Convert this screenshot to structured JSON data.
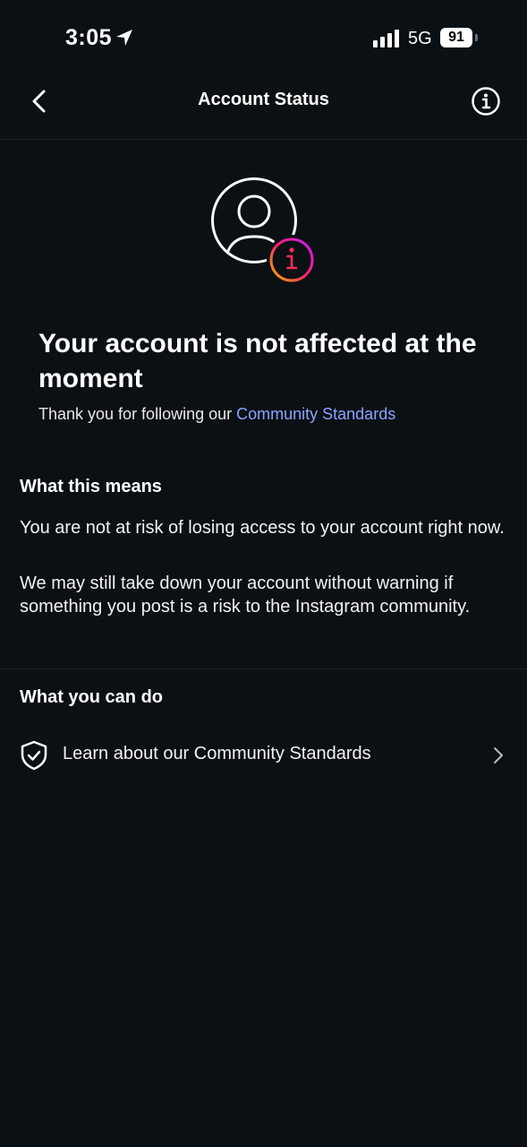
{
  "status_bar": {
    "time": "3:05",
    "network": "5G",
    "battery": "91"
  },
  "nav": {
    "title": "Account Status"
  },
  "status": {
    "headline": "Your account is not affected at the moment",
    "subtitle_prefix": "Thank you for following our ",
    "subtitle_link": "Community Standards"
  },
  "what_this_means": {
    "heading": "What this means",
    "paragraphs": [
      "You are not at risk of losing access to your account right now.",
      "We may still take down your account without warning if something you post is a risk to the Instagram community."
    ]
  },
  "what_you_can_do": {
    "heading": "What you can do",
    "items": [
      {
        "label": "Learn about our Community Standards",
        "icon": "shield-check-icon"
      }
    ]
  },
  "colors": {
    "background": "#0b1014",
    "link": "#8aa4ff",
    "gradient_start": "#f7b500",
    "gradient_end": "#c51cff"
  }
}
